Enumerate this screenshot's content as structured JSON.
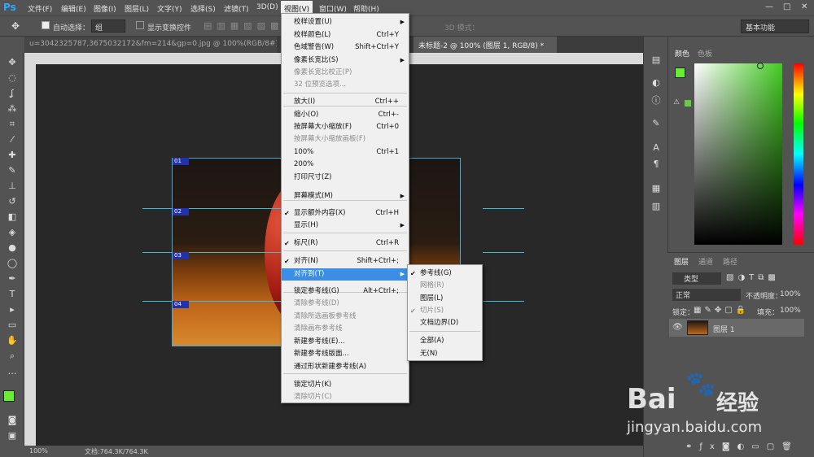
{
  "menubar": {
    "logo": "Ps",
    "items": [
      "文件(F)",
      "编辑(E)",
      "图像(I)",
      "图层(L)",
      "文字(Y)",
      "选择(S)",
      "滤镜(T)",
      "3D(D)",
      "视图(V)",
      "窗口(W)",
      "帮助(H)"
    ],
    "window_controls": [
      "—",
      "□",
      "✕"
    ]
  },
  "options": {
    "auto_select_label": "自动选择：",
    "auto_select_value": "组",
    "transform_label": "显示变换控件",
    "mode_3d": "3D 模式：",
    "workspace": "基本功能"
  },
  "tabs": [
    {
      "label": "u=3042325787,3675032172&fm=214&gp=0.jpg @ 100%(RGB/8#) *"
    },
    {
      "label": "未标题-2 @ 100% (图层 1, RGB/8) *"
    }
  ],
  "view_menu": {
    "items": [
      {
        "label": "校样设置(U)",
        "shortcut": "",
        "submenu": true,
        "disabled": false
      },
      {
        "label": "校样颜色(L)",
        "shortcut": "Ctrl+Y",
        "disabled": false
      },
      {
        "label": "色域警告(W)",
        "shortcut": "Shift+Ctrl+Y",
        "disabled": false
      },
      {
        "label": "像素长宽比(S)",
        "shortcut": "",
        "submenu": true,
        "disabled": false
      },
      {
        "label": "像素长宽比校正(P)",
        "shortcut": "",
        "disabled": true
      },
      {
        "label": "32 位预览选项...",
        "shortcut": "",
        "disabled": true
      },
      {
        "label": "放大(I)",
        "shortcut": "Ctrl++",
        "disabled": false
      },
      {
        "label": "缩小(O)",
        "shortcut": "Ctrl+-",
        "disabled": false
      },
      {
        "label": "按屏幕大小缩放(F)",
        "shortcut": "Ctrl+0",
        "disabled": false
      },
      {
        "label": "按屏幕大小缩放画板(F)",
        "shortcut": "",
        "disabled": true
      },
      {
        "label": "100%",
        "shortcut": "Ctrl+1",
        "disabled": false
      },
      {
        "label": "200%",
        "shortcut": "",
        "disabled": false
      },
      {
        "label": "打印尺寸(Z)",
        "shortcut": "",
        "disabled": false
      },
      {
        "label": "屏幕模式(M)",
        "shortcut": "",
        "submenu": true,
        "disabled": false
      },
      {
        "label": "显示额外内容(X)",
        "shortcut": "Ctrl+H",
        "checked": true,
        "disabled": false
      },
      {
        "label": "显示(H)",
        "shortcut": "",
        "submenu": true,
        "disabled": false
      },
      {
        "label": "标尺(R)",
        "shortcut": "Ctrl+R",
        "checked": true,
        "disabled": false
      },
      {
        "label": "对齐(N)",
        "shortcut": "Shift+Ctrl+;",
        "checked": true,
        "disabled": false
      },
      {
        "label": "对齐到(T)",
        "shortcut": "",
        "submenu": true,
        "highlighted": true,
        "disabled": false
      },
      {
        "label": "锁定参考线(G)",
        "shortcut": "Alt+Ctrl+;",
        "disabled": false
      },
      {
        "label": "清除参考线(D)",
        "shortcut": "",
        "disabled": true
      },
      {
        "label": "清除所选画板参考线",
        "shortcut": "",
        "disabled": true
      },
      {
        "label": "清除画布参考线",
        "shortcut": "",
        "disabled": true
      },
      {
        "label": "新建参考线(E)...",
        "shortcut": "",
        "disabled": false
      },
      {
        "label": "新建参考线版面...",
        "shortcut": "",
        "disabled": false
      },
      {
        "label": "通过形状新建参考线(A)",
        "shortcut": "",
        "disabled": false
      },
      {
        "label": "锁定切片(K)",
        "shortcut": "",
        "disabled": false
      },
      {
        "label": "清除切片(C)",
        "shortcut": "",
        "disabled": true
      }
    ]
  },
  "snap_submenu": {
    "items": [
      {
        "label": "参考线(G)",
        "checked": true,
        "disabled": false
      },
      {
        "label": "网格(R)",
        "checked": false,
        "disabled": true
      },
      {
        "label": "图层(L)",
        "checked": false,
        "disabled": false
      },
      {
        "label": "切片(S)",
        "checked": true,
        "disabled": true
      },
      {
        "label": "文档边界(D)",
        "checked": false,
        "disabled": false
      },
      {
        "label": "全部(A)",
        "checked": false,
        "disabled": false
      },
      {
        "label": "无(N)",
        "checked": false,
        "disabled": false
      }
    ]
  },
  "slices": [
    "01",
    "02",
    "03",
    "04"
  ],
  "panels": {
    "color_tab": "颜色",
    "swatch_tab": "色板",
    "layers_tab": "图层",
    "channels_tab": "通道",
    "paths_tab": "路径",
    "kind_filter": "类型",
    "blend_mode": "正常",
    "opacity_label": "不透明度：",
    "opacity_value": "100%",
    "lock_label": "锁定：",
    "fill_label": "填充：",
    "fill_value": "100%",
    "layer_name": "图层 1"
  },
  "status": {
    "zoom": "100%",
    "doc": "文档:764.3K/764.3K"
  },
  "watermark": {
    "line1": "Bai",
    "line1b": "经验",
    "line2": "jingyan.baidu.com"
  },
  "colors": {
    "foreground": "#66ee33",
    "accent": "#3a8ee6",
    "guide": "#39c0d8"
  }
}
